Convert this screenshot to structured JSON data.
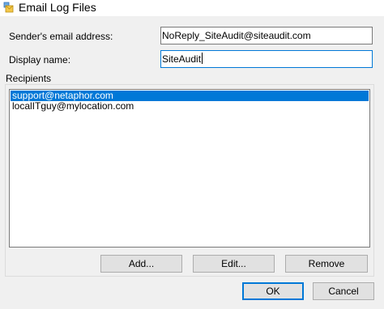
{
  "window": {
    "title": "Email Log Files",
    "icon": "envelope-app-icon"
  },
  "form": {
    "sender_label": "Sender's email address:",
    "sender_value": "NoReply_SiteAudit@siteaudit.com",
    "display_label": "Display name:",
    "display_value": "SiteAudit"
  },
  "recipients": {
    "group_label": "Recipients",
    "items": [
      {
        "label": "support@netaphor.com",
        "selected": true
      },
      {
        "label": "localITguy@mylocation.com",
        "selected": false
      }
    ],
    "add_label": "Add...",
    "edit_label": "Edit...",
    "remove_label": "Remove"
  },
  "footer": {
    "ok_label": "OK",
    "cancel_label": "Cancel"
  },
  "colors": {
    "selection": "#0078d7",
    "focus_border": "#0078d7",
    "dialog_bg": "#f0f0f0"
  }
}
